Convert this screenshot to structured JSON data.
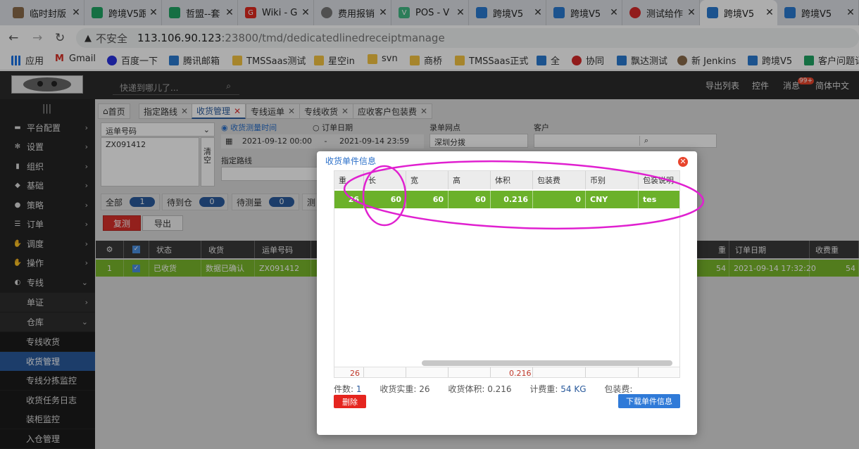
{
  "browser": {
    "tabs": [
      {
        "title": "临时封版",
        "icon": "avatar-icon"
      },
      {
        "title": "跨境V5跟",
        "icon": "sheets-icon"
      },
      {
        "title": "哲盟--套",
        "icon": "sheets-icon"
      },
      {
        "title": "Wiki - G",
        "icon": "wiki-icon"
      },
      {
        "title": "费用报销",
        "icon": "globe-icon"
      },
      {
        "title": "POS - V",
        "icon": "vue-icon"
      },
      {
        "title": "跨境V5",
        "icon": "kj-icon"
      },
      {
        "title": "跨境V5",
        "icon": "kj-icon"
      },
      {
        "title": "测试给作",
        "icon": "arc-icon"
      },
      {
        "title": "跨境V5",
        "icon": "kj-icon"
      },
      {
        "title": "跨境V5",
        "icon": "kj-icon"
      }
    ],
    "tab_close": "✕",
    "security": "不安全",
    "url_host": "113.106.90.123",
    "url_rest": ":23800/tmd/dedicatedlinedreceiptmanage",
    "bookmarks": [
      "应用",
      "Gmail",
      "百度一下",
      "腾讯邮箱",
      "TMSSaas测试",
      "星空in",
      "svn",
      "商桥",
      "TMSSaas正式",
      "全",
      "协同",
      "飘达测试",
      "新 Jenkins",
      "跨境V5",
      "客户问题记"
    ]
  },
  "header": {
    "search_placeholder": "快递到哪儿了...",
    "links": [
      "导出列表",
      "控件",
      "消息",
      "简体中文"
    ],
    "msg_badge": "99+"
  },
  "sidebar": {
    "items": [
      "平台配置",
      "设置",
      "组织",
      "基础",
      "策略",
      "订单",
      "调度",
      "操作",
      "专线"
    ],
    "sub_items": [
      "单证",
      "仓库"
    ],
    "leaf_items": [
      "专线收货",
      "收货管理",
      "专线分拣监控",
      "收货任务日志",
      "装柜监控",
      "入仓管理"
    ]
  },
  "page_tabs": [
    {
      "label": "首页"
    },
    {
      "label": "指定路线"
    },
    {
      "label": "收货管理"
    },
    {
      "label": "专线运单"
    },
    {
      "label": "专线收货"
    },
    {
      "label": "应收客户包装费"
    }
  ],
  "filters": {
    "waybill_select": "运单号码",
    "waybill_value": "ZX091412",
    "clear_label": "清空",
    "radio_time1": "收货测量时间",
    "radio_time2": "订单日期",
    "date_from": "2021-09-12 00:00",
    "date_sep": "-",
    "date_to": "2021-09-14 23:59",
    "site_label": "录单网点",
    "site_value": "深圳分拨",
    "customer_label": "客户",
    "route_label": "指定路线"
  },
  "status_tabs": [
    {
      "label": "全部",
      "count": "1"
    },
    {
      "label": "待到仓",
      "count": "0"
    },
    {
      "label": "待测量",
      "count": "0"
    },
    {
      "label": "测",
      "count": ""
    }
  ],
  "actions": {
    "remeasure": "复测",
    "export": "导出"
  },
  "grid": {
    "headers": [
      "状态",
      "收货",
      "运单号码",
      "重",
      "订单日期",
      "收费重"
    ],
    "row": {
      "index": "1",
      "status": "已收货",
      "receipt": "数据已确认",
      "waybill": "ZX091412",
      "weight": "54",
      "order_date": "2021-09-14 17:32:20",
      "fee_weight": "54"
    }
  },
  "modal": {
    "title": "收货单件信息",
    "headers": [
      "重",
      "长",
      "宽",
      "高",
      "体积",
      "包装费",
      "币别",
      "包装说明"
    ],
    "row": {
      "weight": "26",
      "length": "60",
      "width": "60",
      "height": "60",
      "volume": "0.216",
      "pack_fee": "0",
      "currency": "CNY",
      "pack_desc": "tes"
    },
    "footer": {
      "weight": "26",
      "volume": "0.216"
    },
    "summary": {
      "pieces_label": "件数:",
      "pieces": "1",
      "weight_label": "收货实重:",
      "weight": "26",
      "volume_label": "收货体积:",
      "volume": "0.216",
      "fee_weight_label": "计费重:",
      "fee_weight": "54 KG",
      "pack_fee_label": "包装费:"
    },
    "delete_button": "删除",
    "download_button": "下载单件信息"
  },
  "colors": {
    "row_green": "#6bb12a",
    "accent_blue": "#2a5a9c",
    "annotation": "#e020d0"
  }
}
